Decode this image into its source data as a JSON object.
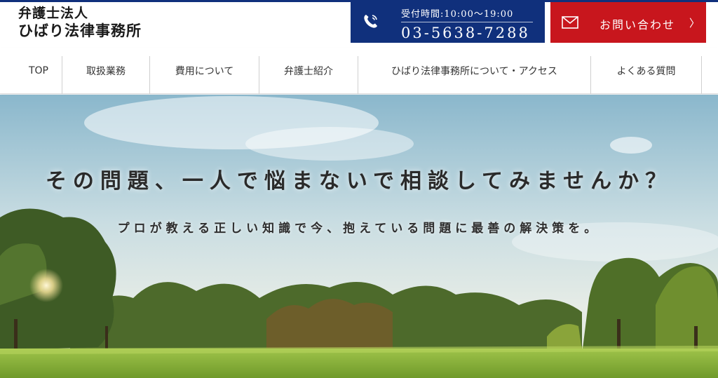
{
  "header": {
    "logo_line1": "弁護士法人",
    "logo_line2": "ひばり法律事務所",
    "phone_hours": "受付時間:10:00〜19:00",
    "phone_number": "03-5638-7288",
    "contact_label": "お問い合わせ",
    "contact_chevron": "〉",
    "icons": {
      "phone": "phone-icon",
      "mail": "mail-icon"
    }
  },
  "nav": {
    "items": [
      {
        "label": "TOP"
      },
      {
        "label": "取扱業務"
      },
      {
        "label": "費用について"
      },
      {
        "label": "弁護士紹介"
      },
      {
        "label": "ひばり法律事務所について・アクセス"
      },
      {
        "label": "よくある質問"
      }
    ]
  },
  "hero": {
    "headline": "その問題、一人で悩まないで相談してみませんか？",
    "subline": "プロが教える正しい知識で今、抱えている問題に最善の解決策を。"
  },
  "colors": {
    "brand_navy": "#10307c",
    "contact_red": "#c8161d",
    "text_dark": "#2a2a2a"
  }
}
